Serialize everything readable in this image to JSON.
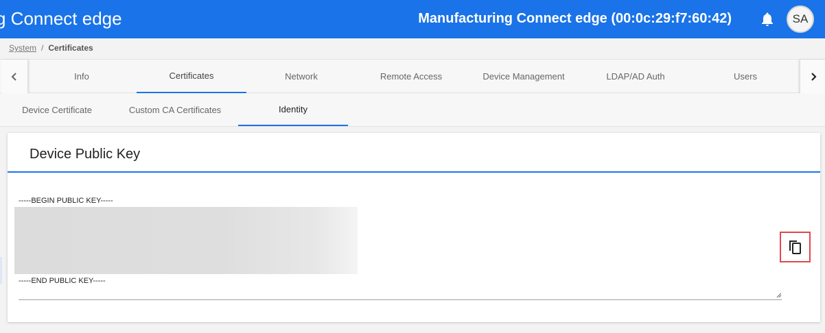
{
  "header": {
    "app_title": "g Connect edge",
    "device_title": "Manufacturing Connect edge (00:0c:29:f7:60:42)",
    "notification_icon": "bell-icon",
    "avatar_initials": "SA",
    "background_color": "#1a73e8"
  },
  "breadcrumb": {
    "parent": "System",
    "separator": "/",
    "current": "Certificates"
  },
  "main_tabs": {
    "prev_icon": "chevron-left-icon",
    "next_icon": "chevron-right-icon",
    "items": [
      {
        "label": "Info",
        "active": false
      },
      {
        "label": "Certificates",
        "active": true
      },
      {
        "label": "Network",
        "active": false
      },
      {
        "label": "Remote Access",
        "active": false
      },
      {
        "label": "Device Management",
        "active": false
      },
      {
        "label": "LDAP/AD Auth",
        "active": false
      },
      {
        "label": "Users",
        "active": false
      }
    ]
  },
  "sub_tabs": {
    "items": [
      {
        "label": "Device Certificate",
        "active": false
      },
      {
        "label": "Custom CA Certificates",
        "active": false
      },
      {
        "label": "Identity",
        "active": true
      }
    ]
  },
  "card": {
    "title": "Device Public Key",
    "key_begin": "-----BEGIN PUBLIC KEY-----",
    "key_end": "-----END PUBLIC KEY-----",
    "copy_icon": "copy-icon",
    "highlight_color": "#e0474c"
  }
}
